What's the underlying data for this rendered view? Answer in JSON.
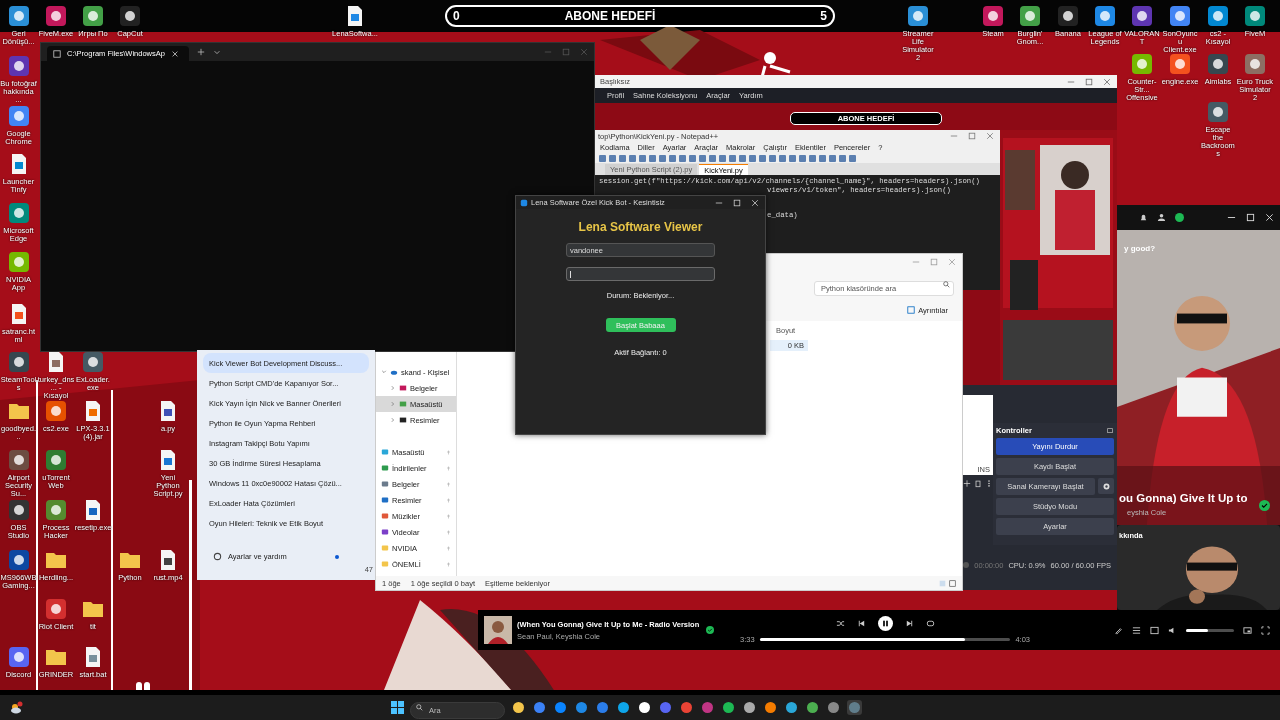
{
  "desktop_icons": [
    {
      "label": "Geri Dönüşü...",
      "kind": "app"
    },
    {
      "label": "FiveM.exe",
      "kind": "app"
    },
    {
      "label": "Игры По",
      "kind": "app"
    },
    {
      "label": "CapCut",
      "kind": "app"
    },
    {
      "label": "LenaSoftwa...",
      "kind": "file"
    },
    {
      "label": "Bu fotoğraf hakkında ...",
      "kind": "app"
    },
    {
      "label": "Google Chrome",
      "kind": "app"
    },
    {
      "label": "Launcher Tinfy",
      "kind": "file"
    },
    {
      "label": "Microsoft Edge",
      "kind": "app"
    },
    {
      "label": "NVIDIA App",
      "kind": "app"
    },
    {
      "label": "satranc.html",
      "kind": "file"
    },
    {
      "label": "SteamTools",
      "kind": "app"
    },
    {
      "label": "turkey_dns... - Kısayol",
      "kind": "file"
    },
    {
      "label": "ExLoader.exe",
      "kind": "app"
    },
    {
      "label": "goodbyed...",
      "kind": "folder"
    },
    {
      "label": "cs2.exe",
      "kind": "app"
    },
    {
      "label": "LPX-3.3.1 (4).jar",
      "kind": "file"
    },
    {
      "label": "a.py",
      "kind": "file"
    },
    {
      "label": "Airport Security Su...",
      "kind": "app"
    },
    {
      "label": "uTorrent Web",
      "kind": "app"
    },
    {
      "label": "Yeni Python Script.py",
      "kind": "file"
    },
    {
      "label": "OBS Studio",
      "kind": "app"
    },
    {
      "label": "Process Hacker",
      "kind": "app"
    },
    {
      "label": "resetip.exe",
      "kind": "file"
    },
    {
      "label": "MS966WB Gaming...",
      "kind": "app"
    },
    {
      "label": "Herdling...",
      "kind": "folder"
    },
    {
      "label": "Python",
      "kind": "folder"
    },
    {
      "label": "rust.mp4",
      "kind": "file"
    },
    {
      "label": "Riot Client",
      "kind": "app"
    },
    {
      "label": "tit",
      "kind": "folder"
    },
    {
      "label": "Discord",
      "kind": "app"
    },
    {
      "label": "GRINDER",
      "kind": "folder"
    },
    {
      "label": "start.bat",
      "kind": "file"
    },
    {
      "label": "Streamer Life Simulator 2",
      "kind": "app"
    },
    {
      "label": "Steam",
      "kind": "app"
    },
    {
      "label": "Burglin' Gnom...",
      "kind": "app"
    },
    {
      "label": "Banana",
      "kind": "app"
    },
    {
      "label": "League of Legends",
      "kind": "app"
    },
    {
      "label": "VALORANT",
      "kind": "app"
    },
    {
      "label": "SonOyuncu Client.exe",
      "kind": "app"
    },
    {
      "label": "cs2 - Kısayol",
      "kind": "app"
    },
    {
      "label": "FiveM",
      "kind": "app"
    },
    {
      "label": "Counter-Str... Offensive",
      "kind": "app"
    },
    {
      "label": "engine.exe",
      "kind": "app"
    },
    {
      "label": "Aimlabs",
      "kind": "app"
    },
    {
      "label": "Euro Truck Simulator 2",
      "kind": "app"
    },
    {
      "label": "Escape the Backrooms",
      "kind": "app"
    }
  ],
  "subscriber_goal": {
    "start": "0",
    "label": "ABONE HEDEFİ",
    "end": "5"
  },
  "terminal": {
    "tab_title": "C:\\Program Files\\WindowsAp"
  },
  "obs": {
    "title": "Başlıksız",
    "menu": [
      "Profil",
      "Sahne Koleksiyonu",
      "Araçlar",
      "Yardım"
    ],
    "preview": {
      "goal_label": "ABONE HEDEFİ",
      "notepad": {
        "title": "top\\Python\\KickYeni.py - Notepad++",
        "menu": [
          "Kodlama",
          "Diller",
          "Ayarlar",
          "Araçlar",
          "Makrolar",
          "Çalıştır",
          "Eklentiler",
          "Pencereler",
          "?"
        ],
        "tabs": [
          {
            "label": "Yeni Python Script (2).py",
            "selected": false
          },
          {
            "label": "KickYeni.py",
            "selected": true
          }
        ],
        "code": [
          "session.get(f\"https://kick.com/api/v2/channels/{channel_name}\", headers=headers).json()",
          "viewers/v1/token\", headers=headers).json()",
          "e_data)"
        ]
      }
    },
    "editor_mode": "INS",
    "controls_title": "Kontroller",
    "controls": [
      {
        "label": "Yayını Durdur",
        "active": true,
        "settings": false
      },
      {
        "label": "Kaydı Başlat",
        "active": false,
        "settings": false
      },
      {
        "label": "Sanal Kamerayı Başlat",
        "active": false,
        "settings": true
      },
      {
        "label": "Stüdyo Modu",
        "active": false,
        "settings": false
      },
      {
        "label": "Ayarlar",
        "active": false,
        "settings": false
      }
    ],
    "status": {
      "time": "00:00:00",
      "cpu": "CPU: 0.9%",
      "fps": "60.00 / 60.00 FPS"
    }
  },
  "chat_history": {
    "items": [
      {
        "label": "Kick Viewer Bot Development Discuss...",
        "selected": true
      },
      {
        "label": "Python Script CMD'de Kapanıyor Sor...",
        "selected": false
      },
      {
        "label": "Kick Yayın İçin Nick ve Banner Önerileri",
        "selected": false
      },
      {
        "label": "Python ile Oyun Yapma Rehberi",
        "selected": false
      },
      {
        "label": "Instagram Takipçi Botu Yapımı",
        "selected": false
      },
      {
        "label": "30 GB İndirme Süresi Hesaplama",
        "selected": false
      },
      {
        "label": "Windows 11 0xc0e90002 Hatası Çözü...",
        "selected": false
      },
      {
        "label": "ExLoader Hata Çözümleri",
        "selected": false
      },
      {
        "label": "Oyun Hileleri: Teknik ve Etik Boyut",
        "selected": false
      }
    ],
    "footer": "Ayarlar ve yardım",
    "notification": true,
    "edge_text": "47"
  },
  "explorer": {
    "search_placeholder": "Python klasöründe ara",
    "details_button": "Ayrıntılar",
    "tree": [
      {
        "label": "skand - Kişisel",
        "expanded": true,
        "children": [
          {
            "label": "Belgeler",
            "selected": false
          },
          {
            "label": "Masaüstü",
            "selected": true
          },
          {
            "label": "Resimler",
            "selected": false
          }
        ]
      }
    ],
    "quick_access": [
      "Masaüstü",
      "İndirilenler",
      "Belgeler",
      "Resimler",
      "Müzikler",
      "Videolar",
      "NVIDIA",
      "ÖNEMLİ"
    ],
    "column_header": "Boyut",
    "file_size": "0 KB",
    "status": [
      "1 öğe",
      "1 öğe seçildi 0 bayt",
      "Eşitleme bekleniyor"
    ]
  },
  "lena_window": {
    "title": "Lena Software Özel Kick Bot - Kesintisiz",
    "heading": "Lena Software Viewer",
    "fields": [
      {
        "value": "vandonee",
        "focused": false
      },
      {
        "focused": true
      }
    ],
    "status": "Durum: Bekleniyor...",
    "start_button": "Başlat Babaaa",
    "connections": "Aktif Bağlantı: 0"
  },
  "spotify": {
    "greeting": "y good?",
    "song_title": "ou Gonna) Give It Up to",
    "artist": "eyshia Cole",
    "saved": true,
    "section": "kkında"
  },
  "player": {
    "title": "(When You Gonna) Give It Up to Me - Radio Version",
    "artist": "Sean Paul, Keyshia Cole",
    "liked": true,
    "playing": true,
    "elapsed": "3:33",
    "duration": "4:03",
    "progress": {
      "level": 0.82
    },
    "volume": {
      "level": 0.45
    }
  },
  "taskbar": {
    "search_placeholder": "Ara"
  }
}
